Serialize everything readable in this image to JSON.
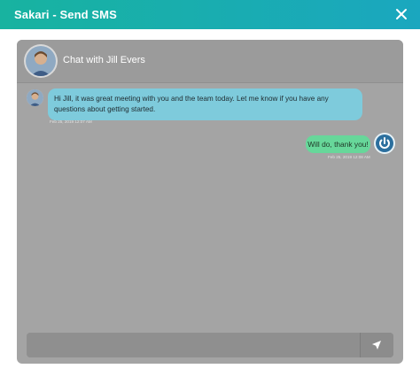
{
  "window": {
    "title": "Sakari - Send SMS",
    "close_icon": "close-icon"
  },
  "chat": {
    "header_title": "Chat with Jill Evers",
    "header_avatar_icon": "contact-avatar",
    "messages": [
      {
        "direction": "incoming",
        "text": "Hi Jill, it was great meeting with you and the team today. Let me know if you have any questions about getting started.",
        "timestamp": "Feb 25, 2019 12:07 AM",
        "bubble_color": "#7ecbdc"
      },
      {
        "direction": "outgoing",
        "text": "Will do, thank you!",
        "timestamp": "Feb 25, 2019 12:08 AM",
        "bubble_color": "#67d79a"
      }
    ]
  },
  "composer": {
    "value": "",
    "placeholder": "",
    "send_icon": "send-icon"
  },
  "colors": {
    "header_gradient_start": "#18b3a0",
    "header_gradient_end": "#1aa7bf",
    "panel_bg": "#a4a4a4"
  }
}
